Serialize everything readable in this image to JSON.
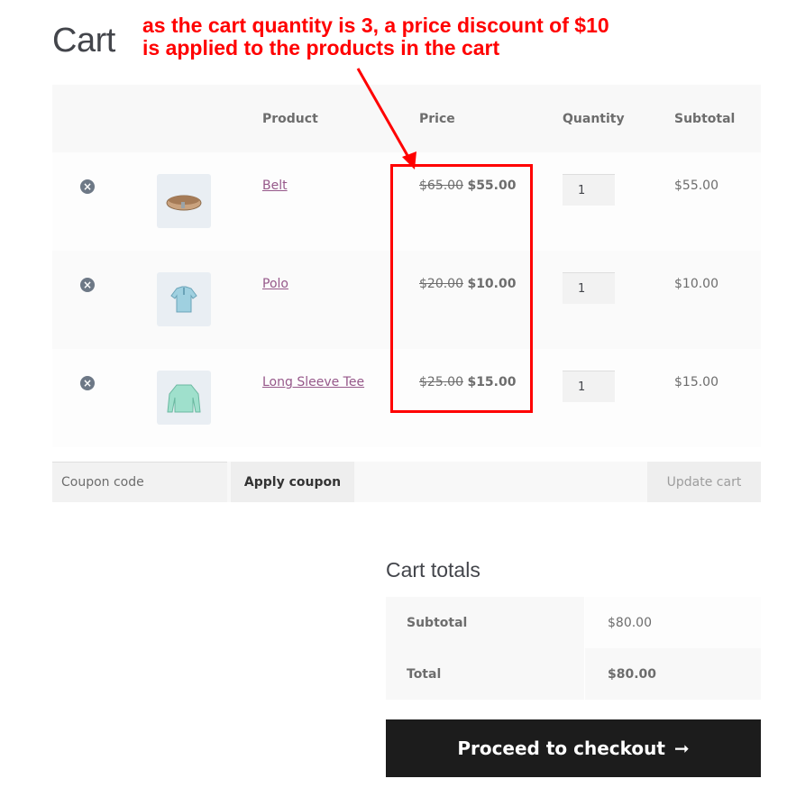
{
  "page": {
    "title": "Cart"
  },
  "annotation": {
    "text": "as the cart quantity is 3, a price discount of $10 is applied to the products in the cart",
    "color": "#ff0000"
  },
  "table": {
    "headers": {
      "product": "Product",
      "price": "Price",
      "quantity": "Quantity",
      "subtotal": "Subtotal"
    },
    "rows": [
      {
        "name": "Belt",
        "image_icon": "belt-icon",
        "old_price": "$65.00",
        "new_price": "$55.00",
        "quantity": "1",
        "subtotal": "$55.00",
        "remove_icon": "×"
      },
      {
        "name": "Polo",
        "image_icon": "polo-shirt-icon",
        "old_price": "$20.00",
        "new_price": "$10.00",
        "quantity": "1",
        "subtotal": "$10.00",
        "remove_icon": "×"
      },
      {
        "name": "Long Sleeve Tee",
        "image_icon": "long-sleeve-tee-icon",
        "old_price": "$25.00",
        "new_price": "$15.00",
        "quantity": "1",
        "subtotal": "$15.00",
        "remove_icon": "×"
      }
    ]
  },
  "actions": {
    "coupon_placeholder": "Coupon code",
    "apply_coupon": "Apply coupon",
    "update_cart": "Update cart"
  },
  "totals": {
    "title": "Cart totals",
    "subtotal_label": "Subtotal",
    "subtotal_value": "$80.00",
    "total_label": "Total",
    "total_value": "$80.00"
  },
  "checkout": {
    "label": "Proceed to checkout",
    "arrow": "➞"
  },
  "colors": {
    "link": "#96588a",
    "checkout_bg": "#1c1c1c",
    "annotation": "#ff0000"
  }
}
